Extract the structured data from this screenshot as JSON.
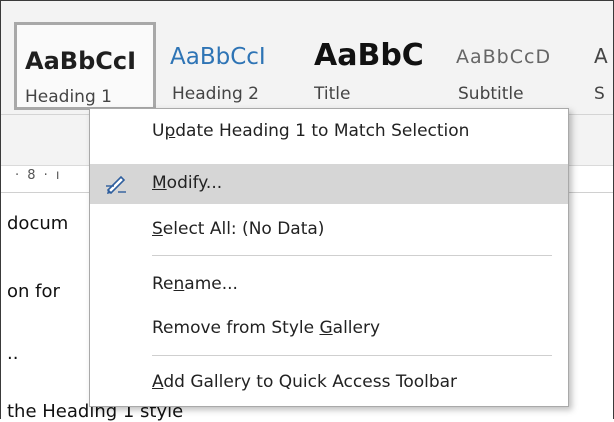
{
  "ribbon": {
    "styles": [
      {
        "sample": "AaBbCcI",
        "name": "Heading 1",
        "sample_color": "#1f1f1f",
        "sample_weight": "bold",
        "selected": true
      },
      {
        "sample": "AaBbCcI",
        "name": "Heading 2",
        "sample_color": "#2e74b5",
        "sample_weight": "normal",
        "selected": false
      },
      {
        "sample": "AaBbC",
        "name": "Title",
        "sample_color": "#111111",
        "sample_weight": "bold",
        "selected": false
      },
      {
        "sample": "AaBbCcD",
        "name": "Subtitle",
        "sample_color": "#666666",
        "sample_weight": "normal",
        "selected": false
      },
      {
        "sample": "A",
        "name": "S",
        "sample_color": "#444444",
        "sample_weight": "normal",
        "selected": false
      }
    ]
  },
  "ruler": {
    "text": "· 8 · ı"
  },
  "document": {
    "lines": [
      "docum",
      "on for",
      "..",
      "the Heading 1 style"
    ]
  },
  "context_menu": {
    "items": [
      {
        "label": "Update Heading 1 to Match Selection",
        "underline": "p",
        "icon": ""
      },
      {
        "label": "Modify...",
        "underline": "M",
        "icon": "modify-pencil-icon",
        "highlight": true
      },
      {
        "label": "Select All: (No Data)",
        "underline": "S",
        "icon": ""
      },
      {
        "label": "Rename...",
        "underline": "n",
        "icon": ""
      },
      {
        "label": "Remove from Style Gallery",
        "underline": "G",
        "icon": ""
      },
      {
        "label": "Add Gallery to Quick Access Toolbar",
        "underline": "A",
        "icon": ""
      }
    ]
  },
  "colors": {
    "menu_highlight": "#d6d6d6",
    "heading2_blue": "#2e74b5",
    "icon_blue": "#2f5f9e"
  }
}
